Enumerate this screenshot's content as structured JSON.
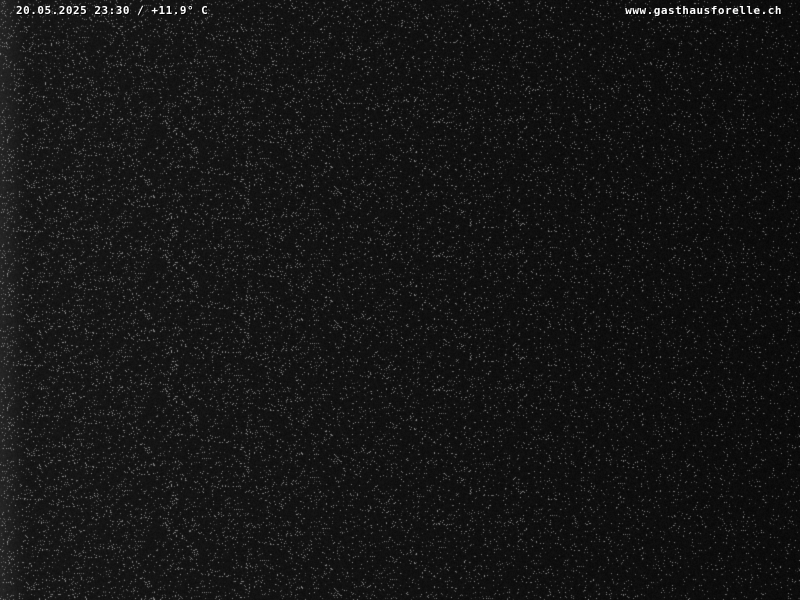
{
  "overlay": {
    "datetime_temp": "20.05.2025 23:30 / +11.9° C",
    "website": "www.gasthausforelle.ch"
  },
  "colors": {
    "background": "#0d0d0d",
    "overlay_text": "#ffffff"
  }
}
